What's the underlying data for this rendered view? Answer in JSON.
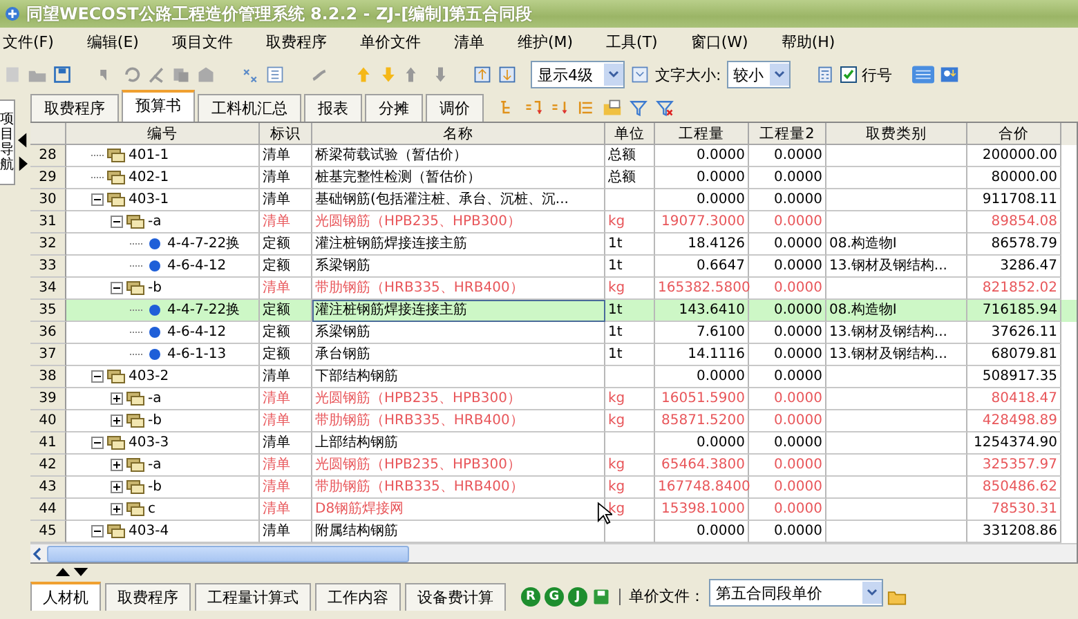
{
  "window": {
    "title": "同望WECOST公路工程造价管理系统 8.2.2 - ZJ-[编制]第五合同段"
  },
  "menu": [
    "文件(F)",
    "编辑(E)",
    "项目文件",
    "取费程序",
    "单价文件",
    "清单",
    "维护(M)",
    "工具(T)",
    "窗口(W)",
    "帮助(H)"
  ],
  "toolbar": {
    "level_select": "显示4级",
    "font_size_label": "文字大小:",
    "font_size": "较小",
    "line_numbers": {
      "label": "行号",
      "checked": true
    }
  },
  "side_tab": "项目导航",
  "tabs": [
    {
      "label": "取费程序",
      "selected": false
    },
    {
      "label": "预算书",
      "selected": true
    },
    {
      "label": "工料机汇总",
      "selected": false
    },
    {
      "label": "报表",
      "selected": false
    },
    {
      "label": "分摊",
      "selected": false
    },
    {
      "label": "调价",
      "selected": false
    }
  ],
  "table": {
    "columns": [
      "编号",
      "标识",
      "名称",
      "单位",
      "工程量",
      "工程量2",
      "取费类别",
      "合价"
    ],
    "rows": [
      {
        "num": "28",
        "code": "401-1",
        "kind": "bill",
        "flag": "清单",
        "name": "桥梁荷载试验（暂估价）",
        "unit": "总额",
        "qty": "0.0000",
        "qty2": "0.0000",
        "total": "200000.00",
        "warning": false,
        "selected": false
      },
      {
        "num": "29",
        "code": "402-1",
        "kind": "bill",
        "flag": "清单",
        "name": "桩基完整性检测（暂估价）",
        "unit": "总额",
        "qty": "0.0000",
        "qty2": "0.0000",
        "total": "80000.00",
        "warning": false,
        "selected": false
      },
      {
        "num": "30",
        "code": "403-1",
        "kind": "bill",
        "flag": "清单",
        "name": "基础钢筋(包括灌注桩、承台、沉桩、沉...",
        "qty": "0.0000",
        "qty2": "0.0000",
        "total": "911708.11",
        "warning": false,
        "selected": false,
        "expanded": true,
        "children": [
          {
            "num": "31",
            "code": "-a",
            "kind": "bill",
            "flag": "清单",
            "name": "光圆钢筋（HPB235、HPB300）",
            "unit": "kg",
            "qty": "19077.3000",
            "qty2": "0.0000",
            "total": "89854.08",
            "warning": true,
            "selected": false,
            "expanded": true,
            "children": [
              {
                "num": "32",
                "code": "4-4-7-22换",
                "kind": "quota",
                "flag": "定额",
                "name": "灌注桩钢筋焊接连接主筋",
                "unit": "1t",
                "qty": "18.4126",
                "qty2": "0.0000",
                "fee": "08.构造物Ⅰ",
                "total": "86578.79",
                "warning": false,
                "selected": false
              },
              {
                "num": "33",
                "code": "4-6-4-12",
                "kind": "quota",
                "flag": "定额",
                "name": "系梁钢筋",
                "unit": "1t",
                "qty": "0.6647",
                "qty2": "0.0000",
                "fee": "13.钢材及钢结构...",
                "total": "3286.47",
                "warning": false,
                "selected": false
              }
            ]
          },
          {
            "num": "34",
            "code": "-b",
            "kind": "bill",
            "flag": "清单",
            "name": "带肋钢筋（HRB335、HRB400）",
            "unit": "kg",
            "qty": "165382.5800",
            "qty2": "0.0000",
            "total": "821852.02",
            "warning": true,
            "selected": false,
            "expanded": true,
            "children": [
              {
                "num": "35",
                "code": "4-4-7-22换",
                "kind": "quota",
                "flag": "定额",
                "name": "灌注桩钢筋焊接连接主筋",
                "unit": "1t",
                "qty": "143.6410",
                "qty2": "0.0000",
                "fee": "08.构造物Ⅰ",
                "total": "716185.94",
                "warning": false,
                "selected": true
              },
              {
                "num": "36",
                "code": "4-6-4-12",
                "kind": "quota",
                "flag": "定额",
                "name": "系梁钢筋",
                "unit": "1t",
                "qty": "7.6100",
                "qty2": "0.0000",
                "fee": "13.钢材及钢结构...",
                "total": "37626.11",
                "warning": false,
                "selected": false
              },
              {
                "num": "37",
                "code": "4-6-1-13",
                "kind": "quota",
                "flag": "定额",
                "name": "承台钢筋",
                "unit": "1t",
                "qty": "14.1116",
                "qty2": "0.0000",
                "fee": "13.钢材及钢结构...",
                "total": "68079.81",
                "warning": false,
                "selected": false
              }
            ]
          }
        ]
      },
      {
        "num": "38",
        "code": "403-2",
        "kind": "bill",
        "flag": "清单",
        "name": "下部结构钢筋",
        "qty": "0.0000",
        "qty2": "0.0000",
        "total": "508917.35",
        "warning": false,
        "selected": false,
        "expanded": true,
        "children": [
          {
            "num": "39",
            "code": "-a",
            "kind": "bill",
            "flag": "清单",
            "name": "光圆钢筋（HPB235、HPB300）",
            "unit": "kg",
            "qty": "16051.5900",
            "qty2": "0.0000",
            "total": "80418.47",
            "warning": true,
            "selected": false,
            "expanded": false
          },
          {
            "num": "40",
            "code": "-b",
            "kind": "bill",
            "flag": "清单",
            "name": "带肋钢筋（HRB335、HRB400）",
            "unit": "kg",
            "qty": "85871.5200",
            "qty2": "0.0000",
            "total": "428498.89",
            "warning": true,
            "selected": false,
            "expanded": false
          }
        ]
      },
      {
        "num": "41",
        "code": "403-3",
        "kind": "bill",
        "flag": "清单",
        "name": "上部结构钢筋",
        "qty": "0.0000",
        "qty2": "0.0000",
        "total": "1254374.90",
        "warning": false,
        "selected": false,
        "expanded": true,
        "children": [
          {
            "num": "42",
            "code": "-a",
            "kind": "bill",
            "flag": "清单",
            "name": "光圆钢筋（HPB235、HPB300）",
            "unit": "kg",
            "qty": "65464.3800",
            "qty2": "0.0000",
            "total": "325357.97",
            "warning": true,
            "selected": false,
            "expanded": false
          },
          {
            "num": "43",
            "code": "-b",
            "kind": "bill",
            "flag": "清单",
            "name": "带肋钢筋（HRB335、HRB400）",
            "unit": "kg",
            "qty": "167748.8400",
            "qty2": "0.0000",
            "total": "850486.62",
            "warning": true,
            "selected": false,
            "expanded": false
          },
          {
            "num": "44",
            "code": "c",
            "kind": "bill",
            "flag": "清单",
            "name": "D8钢筋焊接网",
            "unit": "kg",
            "qty": "15398.1000",
            "qty2": "0.0000",
            "total": "78530.31",
            "warning": true,
            "selected": false,
            "expanded": false
          }
        ]
      },
      {
        "num": "45",
        "code": "403-4",
        "kind": "bill",
        "flag": "清单",
        "name": "附属结构钢筋",
        "qty": "0.0000",
        "qty2": "0.0000",
        "total": "331208.86",
        "warning": false,
        "selected": false,
        "expanded": true
      }
    ]
  },
  "bottom_tabs": [
    {
      "label": "人材机",
      "selected": true
    },
    {
      "label": "取费程序",
      "selected": false
    },
    {
      "label": "工程量计算式",
      "selected": false
    },
    {
      "label": "工作内容",
      "selected": false
    },
    {
      "label": "设备费计算",
      "selected": false
    }
  ],
  "bottom_toolbar": {
    "round_buttons": [
      "R",
      "G",
      "J"
    ],
    "price_file_label": "单价文件：",
    "price_file": "第五合同段单价"
  }
}
